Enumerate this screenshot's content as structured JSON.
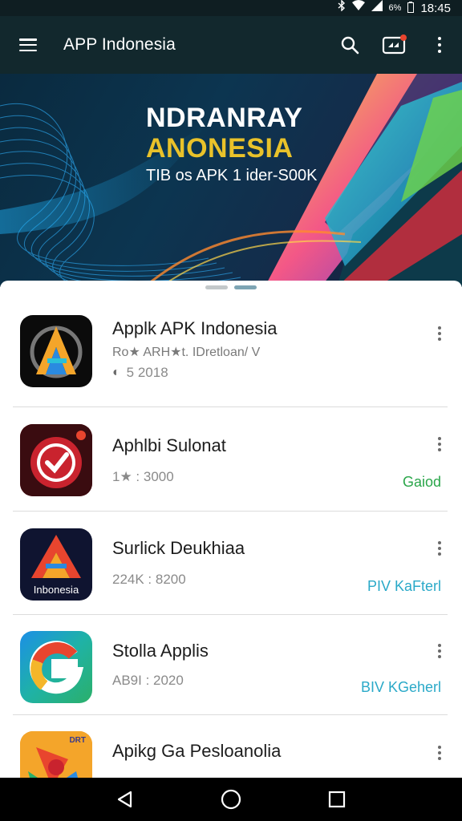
{
  "status_bar": {
    "bluetooth_icon": "bluetooth-icon",
    "wifi_icon": "wifi-icon",
    "signal_icon": "signal-icon",
    "battery_text": "6%",
    "time": "18:45"
  },
  "app_bar": {
    "title": "APP Indonesia",
    "icons": [
      "menu-icon",
      "search-icon",
      "cast-icon",
      "more-vert-icon"
    ],
    "background": "#12282d"
  },
  "banner": {
    "line1": "NDRANRAY",
    "line2": "ANONESIA",
    "line3": "TIB os APK 1 ider-S00K",
    "line1_color": "#ffffff",
    "line2_color": "#e9c22a"
  },
  "apps": [
    {
      "name": "Applk APK Indonesia",
      "developer": "Ro★ ARH★t. IDretloan/ V",
      "meta": "5 2018",
      "action": ""
    },
    {
      "name": "Aphlbi Sulonat",
      "developer": "",
      "meta": "1★ : 3000",
      "action": "Gaiod",
      "action_color": "#2aa64a"
    },
    {
      "name": "Surlick Deukhiaa",
      "developer": "",
      "meta": "224K : 8200",
      "action": "PIV KaFterl",
      "action_color": "#2aa9c8",
      "icon_label": "Inbonesia"
    },
    {
      "name": "Stolla Applis",
      "developer": "",
      "meta": "AB9I : 2020",
      "action": "BIV KGeherl",
      "action_color": "#2aa9c8"
    },
    {
      "name": "Apikg Ga Pesloanolia",
      "developer": "",
      "meta": "",
      "action": "",
      "icon_label": "DRT"
    }
  ],
  "nav_bar": {
    "icons": [
      "back-icon",
      "home-icon",
      "recents-icon"
    ]
  }
}
